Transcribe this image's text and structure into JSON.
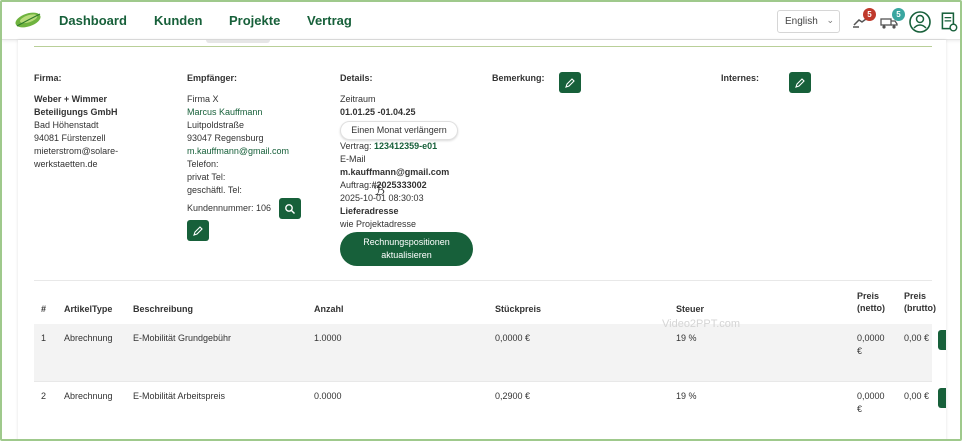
{
  "nav": {
    "links": [
      "Dashboard",
      "Kunden",
      "Projekte",
      "Vertrag"
    ],
    "language": "English",
    "notifications_count": "5",
    "messages_count": "5"
  },
  "colors": {
    "brand": "#17603a",
    "badge_red": "#c0392b",
    "badge_teal": "#3aa6a0"
  },
  "firma": {
    "label": "Firma:",
    "name_line1": "Weber + Wimmer",
    "name_line2": "Beteiligungs GmbH",
    "street": "Bad Höhenstadt",
    "city": "94081 Fürstenzell",
    "email_line1": "mieterstrom@solare-",
    "email_line2": "werkstaetten.de"
  },
  "empfaenger": {
    "label": "Empfänger:",
    "company": "Firma X",
    "person": "Marcus Kauffmann",
    "street": "Luitpoldstraße",
    "city": "93047 Regensburg",
    "email": "m.kauffmann@gmail.com",
    "telefon": "Telefon:",
    "privat": "privat Tel:",
    "geschaeftl": "geschäftl. Tel:",
    "kundennummer": "Kundennummer: 106"
  },
  "details": {
    "label": "Details:",
    "zeitraum_label": "Zeitraum",
    "zeitraum_value": "01.01.25 -01.04.25",
    "extend_button": "Einen Monat verlängern",
    "vertrag_label": "Vertrag:",
    "vertrag_value": "123412359-e01",
    "email_label": "E-Mail",
    "email_value": "m.kauffmann@gmail.com",
    "auftrag_label": "Auftrag:",
    "auftrag_value": "#2025333002",
    "datetime": "2025-10-01 08:30:03",
    "lieferadresse_label": "Lieferadresse",
    "lieferadresse_value": "wie Projektadresse",
    "update_button_line1": "Rechnungspositionen",
    "update_button_line2": "aktualisieren"
  },
  "bemerkung": {
    "label": "Bemerkung:"
  },
  "internes": {
    "label": "Internes:"
  },
  "table": {
    "headers": {
      "num": "#",
      "type": "ArtikelType",
      "desc": "Beschreibung",
      "qty": "Anzahl",
      "unit_price": "Stückpreis",
      "tax": "Steuer",
      "net_1": "Preis",
      "net_2": "(netto)",
      "gross_1": "Preis",
      "gross_2": "(brutto)"
    },
    "rows": [
      {
        "num": "1",
        "type": "Abrechnung",
        "desc": "E-Mobilität Grundgebühr",
        "qty": "1.0000",
        "unit_price": "0,0000 €",
        "tax": "19 %",
        "net_1": "0,0000",
        "net_2": "€",
        "gross": "0,00 €"
      },
      {
        "num": "2",
        "type": "Abrechnung",
        "desc": "E-Mobilität Arbeitspreis",
        "qty": "0.0000",
        "unit_price": "0,2900 €",
        "tax": "19 %",
        "net_1": "0,0000",
        "net_2": "€",
        "gross": "0,00 €"
      }
    ]
  },
  "watermark": "Video2PPT.com"
}
